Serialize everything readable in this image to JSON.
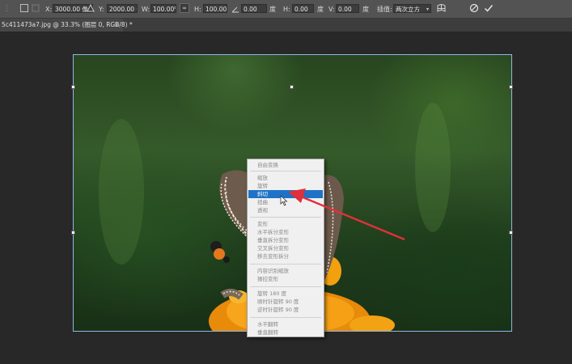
{
  "options_bar": {
    "x_label": "X:",
    "x_value": "3000.00 像",
    "y_label": "Y:",
    "y_value": "2000.00 像",
    "w_label": "W:",
    "w_value": "100.00%",
    "h_label": "H:",
    "h_value": "100.00%",
    "angle_value": "0.00",
    "angle_unit": "度",
    "hskew_label": "H:",
    "hskew_value": "0.00",
    "hskew_unit": "度",
    "vskew_label": "V:",
    "vskew_value": "0.00",
    "vskew_unit": "度",
    "interp_label": "插值:",
    "interp_value": "两次立方"
  },
  "document_tab": {
    "title": "5c411473a7.jpg @ 33.3% (图层 0, RGB/8) *",
    "close": "×"
  },
  "context_menu": {
    "items": [
      "自由变换",
      "缩放",
      "旋转",
      "斜切",
      "扭曲",
      "透视",
      "变形",
      "水平拆分变形",
      "垂直拆分变形",
      "交叉拆分变形",
      "移去变形拆分",
      "内容识别缩放",
      "操控变形",
      "旋转 180 度",
      "顺时针旋转 90 度",
      "逆时针旋转 90 度",
      "水平翻转",
      "垂直翻转"
    ],
    "highlighted": "斜切"
  },
  "colors": {
    "menu_highlight": "#1e73c8",
    "arrow": "#e0303a",
    "bounding_box": "#8fb6e6"
  }
}
